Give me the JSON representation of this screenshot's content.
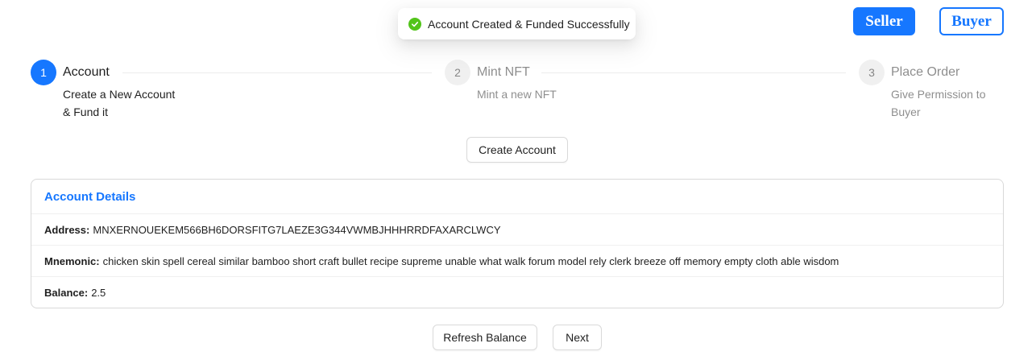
{
  "toast": {
    "message": "Account Created & Funded Successfully",
    "icon": "check-circle-icon",
    "color": "#52c41a"
  },
  "roles": {
    "seller": "Seller",
    "buyer": "Buyer",
    "accent": "#1677ff"
  },
  "steps": [
    {
      "number": "1",
      "title": "Account",
      "desc_line1": "Create a New Account",
      "desc_line2": "& Fund it",
      "status": "active"
    },
    {
      "number": "2",
      "title": "Mint NFT",
      "desc_line1": "Mint a new NFT",
      "desc_line2": "",
      "status": "wait"
    },
    {
      "number": "3",
      "title": "Place Order",
      "desc_line1": "Give Permission to",
      "desc_line2": "Buyer",
      "status": "wait"
    }
  ],
  "create_account_label": "Create Account",
  "account_details": {
    "title": "Account Details",
    "address_label": "Address:",
    "address_value": "MNXERNOUEKEM566BH6DORSFITG7LAEZE3G344VWMBJHHHRRDFAXARCLWCY",
    "mnemonic_label": "Mnemonic:",
    "mnemonic_value": "chicken skin spell cereal similar bamboo short craft bullet recipe supreme unable what walk forum model rely clerk breeze off memory empty cloth able wisdom",
    "balance_label": "Balance:",
    "balance_value": "2.5"
  },
  "actions": {
    "refresh_label": "Refresh Balance",
    "next_label": "Next"
  }
}
